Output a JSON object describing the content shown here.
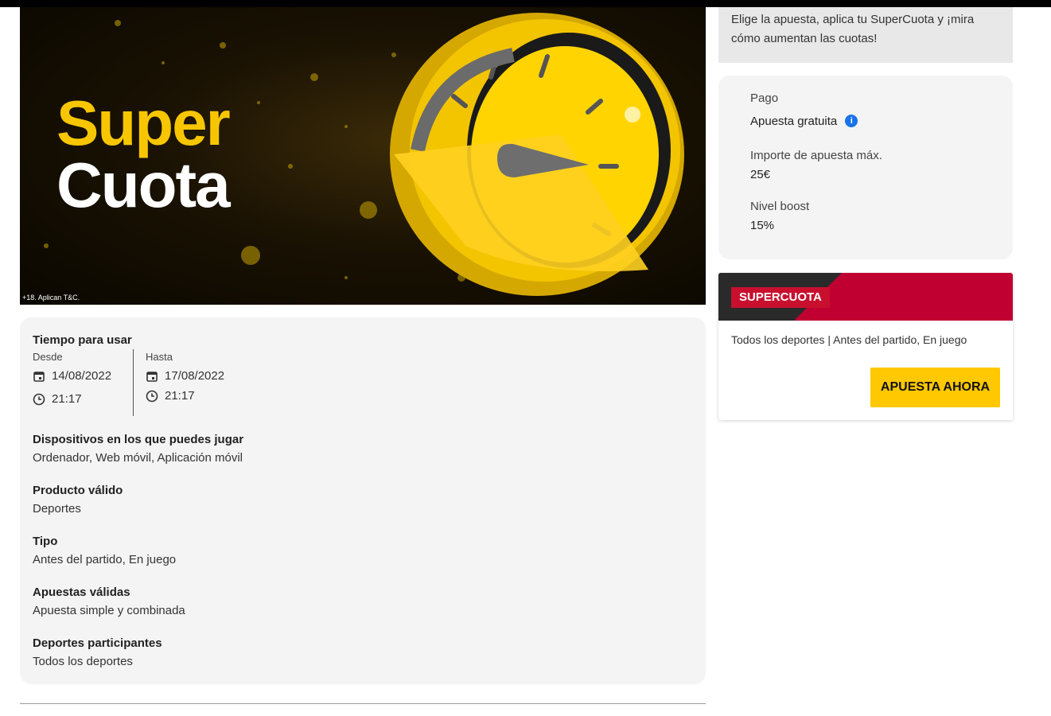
{
  "hero": {
    "title_line1": "Super",
    "title_line2": "Cuota",
    "disclaimer": "+18. Aplican T&C."
  },
  "details": {
    "time_title": "Tiempo para usar",
    "from_label": "Desde",
    "from_date": "14/08/2022",
    "from_time": "21:17",
    "to_label": "Hasta",
    "to_date": "17/08/2022",
    "to_time": "21:17",
    "devices_label": "Dispositivos en los que puedes jugar",
    "devices_value": "Ordenador, Web móvil, Aplicación móvil",
    "product_label": "Producto válido",
    "product_value": "Deportes",
    "type_label": "Tipo",
    "type_value": "Antes del partido, En juego",
    "bets_label": "Apuestas válidas",
    "bets_value": "Apuesta simple y combinada",
    "sports_label": "Deportes participantes",
    "sports_value": "Todos los deportes"
  },
  "note": {
    "text": "Elige la apuesta, aplica tu SuperCuota y ¡mira cómo aumentan las cuotas!"
  },
  "info": {
    "payment_label": "Pago",
    "payment_value": "Apuesta gratuita",
    "info_icon": "info-icon",
    "max_label": "Importe de apuesta máx.",
    "max_value": "25€",
    "boost_label": "Nivel boost",
    "boost_value": "15%"
  },
  "promo": {
    "tag": "SUPERCUOTA",
    "description": "Todos los deportes | Antes del partido, En juego",
    "button": "APUESTA AHORA"
  },
  "colors": {
    "brand_yellow": "#ffc800",
    "brand_red": "#c8102e",
    "info_blue": "#1a73e8"
  }
}
